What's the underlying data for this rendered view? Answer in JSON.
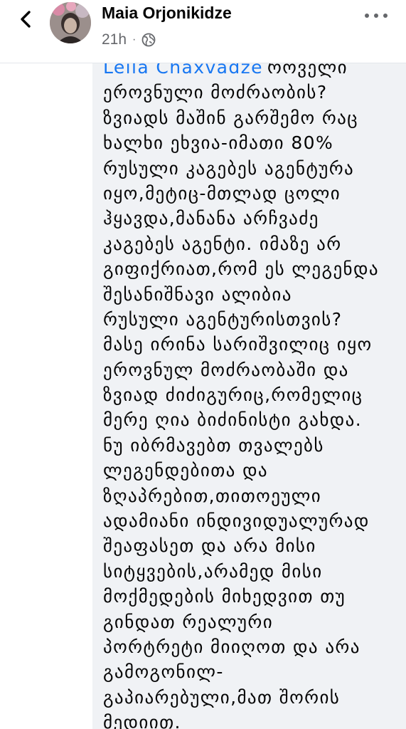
{
  "header": {
    "author_name": "Maia Orjonikidze",
    "time": "21h",
    "separator": "·",
    "audience_icon": "globe-icon",
    "back_icon": "chevron-left-icon",
    "more_icon": "more-dots-icon"
  },
  "comment": {
    "author": "Leila Chaxvadze",
    "first_line_rest": "როველი",
    "lines": [
      "ეროვნული მოძრაობის?",
      "ზვიადს მაშინ გარშემო რაც",
      "ხალხი ეხვია-იმათი 80%",
      "რუსული კაგებეს აგენტურა",
      "იყო,მეტიც-მთლად ცოლი",
      "ჰყავდა,მანანა არჩვაძე",
      "კაგებეს აგენტი. იმაზე არ",
      "გიფიქრიათ,რომ ეს ლეგენდა",
      "შესანიშნავი ალიბია",
      "რუსული აგენტურისთვის?",
      "მასე ირინა სარიშვილიც იყო",
      "ეროვნულ მოძრაობაში და",
      "ზვიად ძიძიგურიც,რომელიც",
      "მერე ღია ბიძინისტი გახდა.",
      "ნუ იბრმავებთ თვალებს",
      "ლეგენდებითა და",
      "ზღაპრებით,თითოეული",
      "ადამიანი ინდივიდუალურად",
      "შეაფასეთ და არა მისი",
      "სიტყვების,არამედ მისი",
      "მოქმედების მიხედვით თუ",
      "გინდათ რეალური",
      "პორტრეტი მიიღოთ და არა",
      "გამოგონილ-",
      "გაპიარებული,მათ შორის",
      "მედიით."
    ]
  },
  "colors": {
    "name_link": "#1877f2",
    "bubble": "#f0f2f5",
    "text": "#050505",
    "meta": "#65676b"
  }
}
